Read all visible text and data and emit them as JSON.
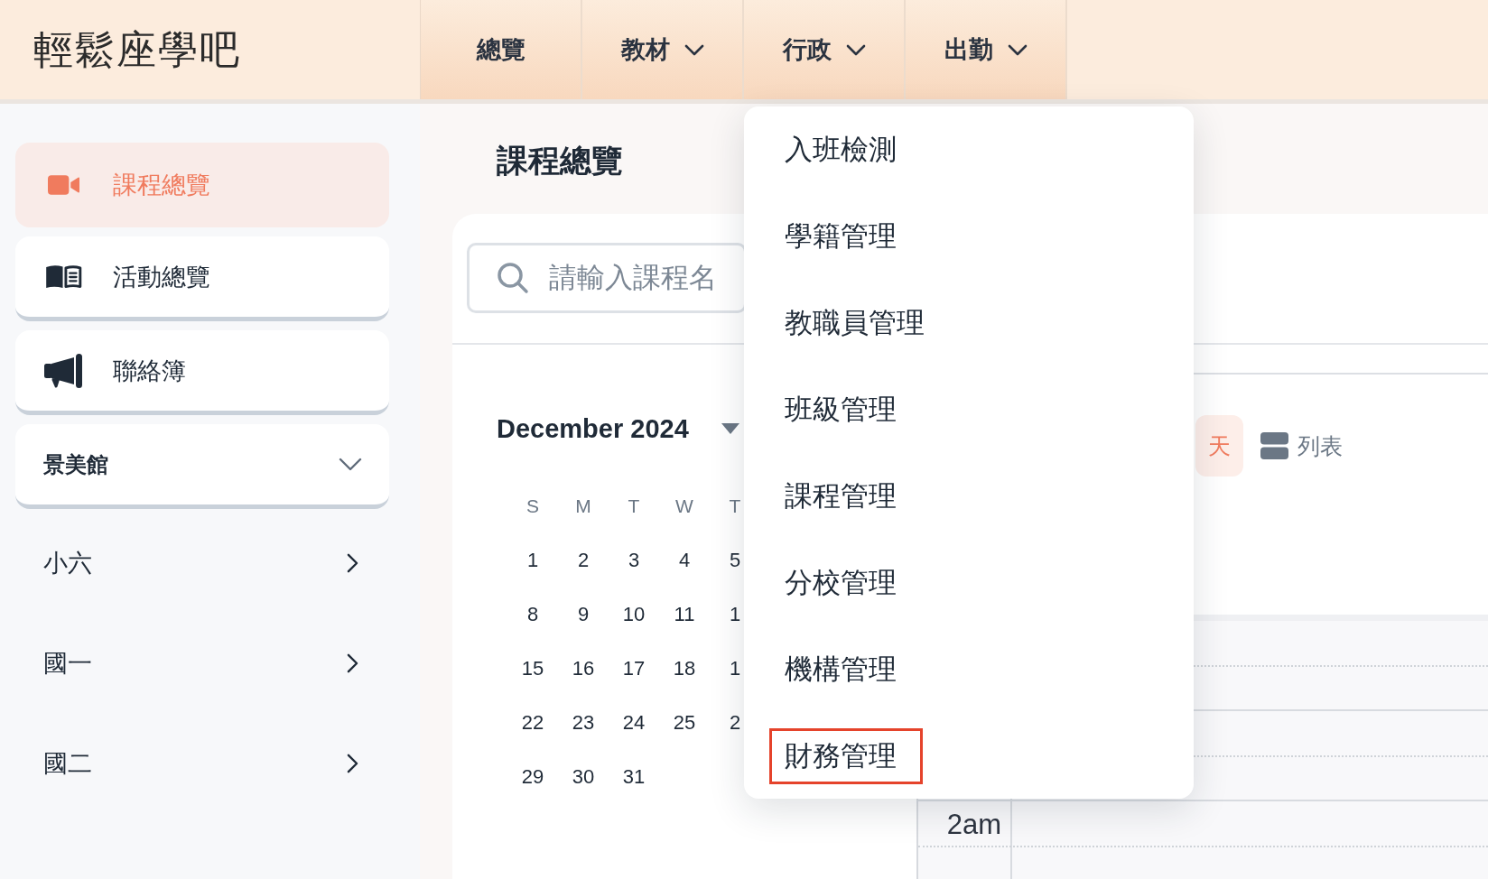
{
  "header": {
    "logo": "輕鬆座學吧",
    "nav": [
      {
        "label": "總覽",
        "dropdown": false
      },
      {
        "label": "教材",
        "dropdown": true
      },
      {
        "label": "行政",
        "dropdown": true,
        "menu": [
          {
            "label": "入班檢測",
            "highlighted": false
          },
          {
            "label": "學籍管理",
            "highlighted": false
          },
          {
            "label": "教職員管理",
            "highlighted": false
          },
          {
            "label": "班級管理",
            "highlighted": false
          },
          {
            "label": "課程管理",
            "highlighted": false
          },
          {
            "label": "分校管理",
            "highlighted": false
          },
          {
            "label": "機構管理",
            "highlighted": false
          },
          {
            "label": "財務管理",
            "highlighted": true
          }
        ]
      },
      {
        "label": "出勤",
        "dropdown": true
      }
    ]
  },
  "sidebar": {
    "items": [
      {
        "label": "課程總覽",
        "selected": true
      },
      {
        "label": "活動總覽",
        "selected": false
      },
      {
        "label": "聯絡簿",
        "selected": false
      }
    ],
    "branch": {
      "label": "景美館",
      "expanded": true,
      "children": [
        {
          "label": "小六",
          "expanded": false
        },
        {
          "label": "國一",
          "expanded": false
        },
        {
          "label": "國二",
          "expanded": false
        }
      ]
    }
  },
  "main": {
    "title": "課程總覽",
    "search": {
      "placeholder": "請輸入課程名"
    },
    "mini_calendar": {
      "month": "December 2024",
      "weekdays": [
        "S",
        "M",
        "T",
        "W",
        "T"
      ],
      "weeks": [
        [
          "1",
          "2",
          "3",
          "4",
          "5"
        ],
        [
          "8",
          "9",
          "10",
          "11",
          "1"
        ],
        [
          "15",
          "16",
          "17",
          "18",
          "1"
        ],
        [
          "22",
          "23",
          "24",
          "25",
          "2"
        ],
        [
          "29",
          "30",
          "31"
        ]
      ]
    },
    "view_switch": [
      {
        "label": "天",
        "selected": true
      },
      {
        "label": "列表",
        "selected": false
      }
    ],
    "time_grid": {
      "hours": [
        "2am"
      ]
    }
  }
}
